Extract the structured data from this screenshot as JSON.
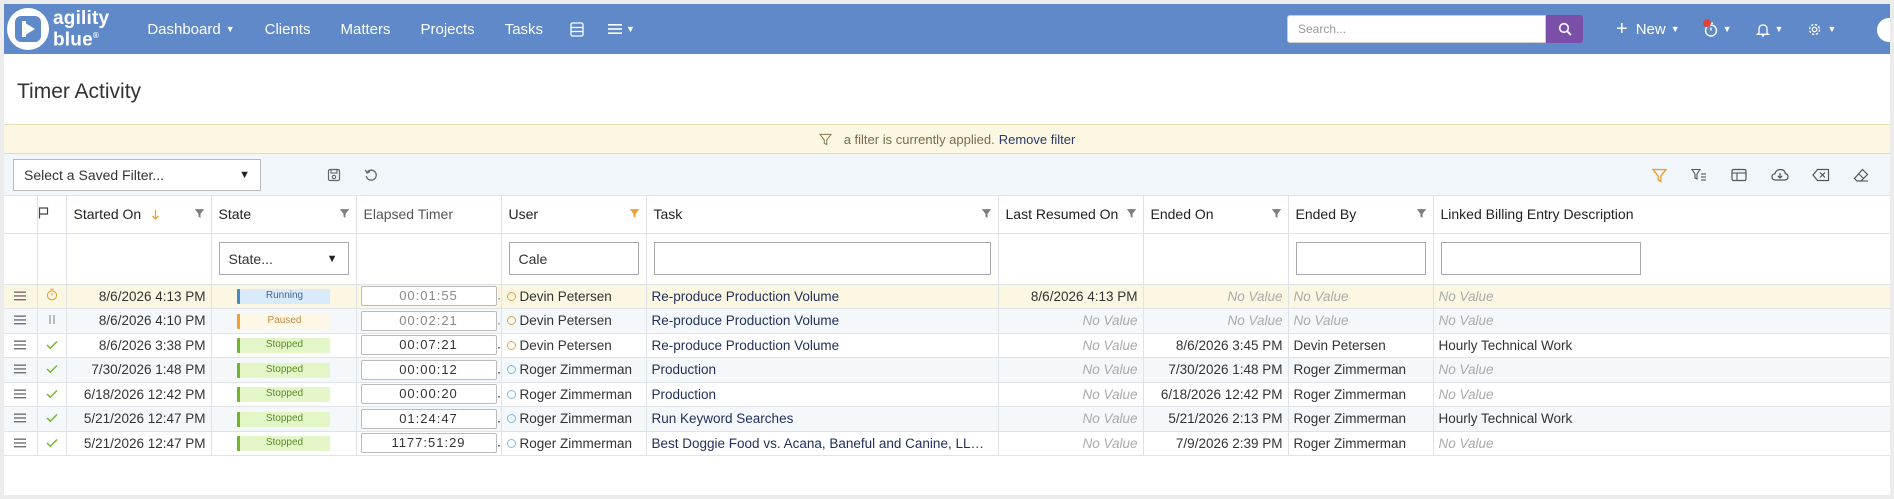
{
  "nav": {
    "logo_line1": "agility",
    "logo_line2": "blue",
    "logo_reg": "®",
    "items": [
      {
        "label": "Dashboard",
        "caret": "▼"
      },
      {
        "label": "Clients"
      },
      {
        "label": "Matters"
      },
      {
        "label": "Projects"
      },
      {
        "label": "Tasks"
      }
    ],
    "search_placeholder": "Search...",
    "new_label": "New",
    "caret": "▼"
  },
  "page": {
    "title": "Timer Activity",
    "filter_notice": "a filter is currently applied.",
    "remove_filter": "Remove filter",
    "saved_filter_placeholder": "Select a Saved Filter..."
  },
  "grid": {
    "columns": [
      "Started On",
      "State",
      "Elapsed Timer",
      "User",
      "Task",
      "Last Resumed On",
      "Ended On",
      "Ended By",
      "Linked Billing Entry Description"
    ],
    "filters": {
      "state": "State...",
      "user": "Cale",
      "task": "",
      "ended_by": "",
      "linked": ""
    },
    "rows": [
      {
        "status_icon": "timer",
        "started_on": "8/6/2026 4:13 PM",
        "state": "Running",
        "elapsed": "00:01:55",
        "user": "Devin Petersen",
        "task": "Re-produce Production Volume",
        "last_resumed": "8/6/2026 4:13 PM",
        "ended_on": "No Value",
        "ended_by": "No Value",
        "linked": "No Value"
      },
      {
        "status_icon": "pause",
        "started_on": "8/6/2026 4:10 PM",
        "state": "Paused",
        "elapsed": "00:02:21",
        "user": "Devin Petersen",
        "task": "Re-produce Production Volume",
        "last_resumed": "No Value",
        "ended_on": "No Value",
        "ended_by": "No Value",
        "linked": "No Value"
      },
      {
        "status_icon": "check",
        "started_on": "8/6/2026 3:38 PM",
        "state": "Stopped",
        "elapsed": "00:07:21",
        "user": "Devin Petersen",
        "task": "Re-produce Production Volume",
        "last_resumed": "No Value",
        "ended_on": "8/6/2026 3:45 PM",
        "ended_by": "Devin Petersen",
        "linked": "Hourly Technical Work"
      },
      {
        "status_icon": "check",
        "started_on": "7/30/2026 1:48 PM",
        "state": "Stopped",
        "elapsed": "00:00:12",
        "user": "Roger Zimmerman",
        "task": "Production",
        "last_resumed": "No Value",
        "ended_on": "7/30/2026 1:48 PM",
        "ended_by": "Roger Zimmerman",
        "linked": "No Value"
      },
      {
        "status_icon": "check",
        "started_on": "6/18/2026 12:42 PM",
        "state": "Stopped",
        "elapsed": "00:00:20",
        "user": "Roger Zimmerman",
        "task": "Production",
        "last_resumed": "No Value",
        "ended_on": "6/18/2026 12:42 PM",
        "ended_by": "Roger Zimmerman",
        "linked": "No Value"
      },
      {
        "status_icon": "check",
        "started_on": "5/21/2026 12:47 PM",
        "state": "Stopped",
        "elapsed": "01:24:47",
        "user": "Roger Zimmerman",
        "task": "Run Keyword Searches",
        "last_resumed": "No Value",
        "ended_on": "5/21/2026 2:13 PM",
        "ended_by": "Roger Zimmerman",
        "linked": "Hourly Technical Work"
      },
      {
        "status_icon": "check",
        "started_on": "5/21/2026 12:47 PM",
        "state": "Stopped",
        "elapsed": "1177:51:29",
        "user": "Roger Zimmerman",
        "task": "Best Doggie Food vs. Acana, Baneful and Canine, LLC New Database Setup",
        "last_resumed": "No Value",
        "ended_on": "7/9/2026 2:39 PM",
        "ended_by": "Roger Zimmerman",
        "linked": "No Value"
      }
    ]
  },
  "colors": {
    "nav_bg": "#5f89c9",
    "search_button": "#7b4fa8",
    "filter_bar_bg": "#fbf7e3",
    "active_filter_icon": "#f0a030",
    "running": "#4a89c8",
    "paused": "#f0a030",
    "stopped": "#6fb52a"
  }
}
